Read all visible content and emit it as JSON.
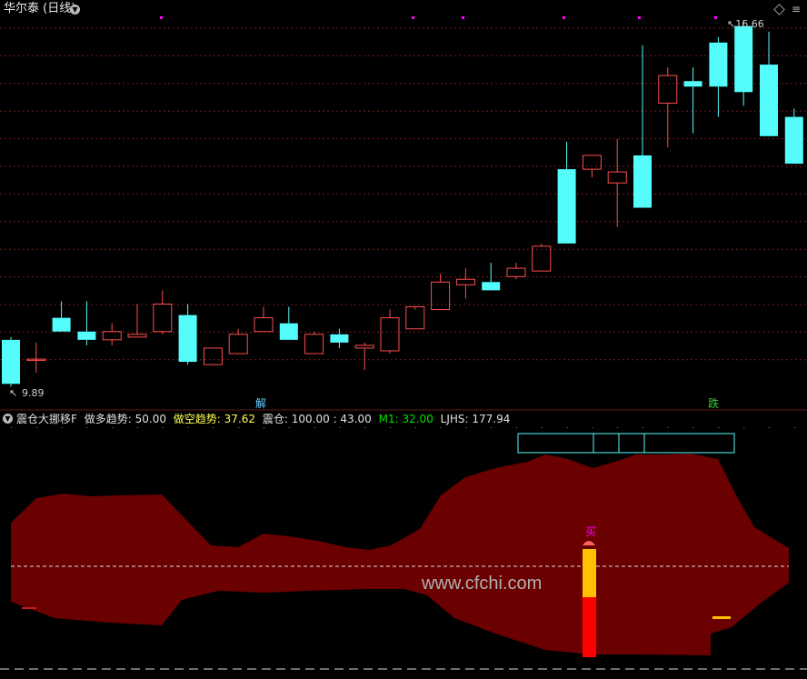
{
  "header": {
    "title": "华尔泰 (日线)",
    "dropdown_icon": "chevron-down-icon",
    "right_icons": [
      "diamond-icon",
      "menu-icon"
    ]
  },
  "price_chart": {
    "high_label": "16.66",
    "low_label": "9.89",
    "signal_tags": {
      "jie": "解",
      "die": "跌"
    },
    "candles": [
      {
        "o": 10.85,
        "h": 10.9,
        "l": 10.0,
        "c": 10.05
      },
      {
        "o": 10.5,
        "h": 10.8,
        "l": 10.25,
        "c": 10.5
      },
      {
        "o": 11.25,
        "h": 11.55,
        "l": 11.0,
        "c": 11.0
      },
      {
        "o": 11.0,
        "h": 11.55,
        "l": 10.75,
        "c": 10.85
      },
      {
        "o": 10.85,
        "h": 11.15,
        "l": 10.75,
        "c": 11.0
      },
      {
        "o": 10.9,
        "h": 11.5,
        "l": 10.9,
        "c": 10.95
      },
      {
        "o": 11.0,
        "h": 11.75,
        "l": 10.95,
        "c": 11.5
      },
      {
        "o": 11.3,
        "h": 11.5,
        "l": 10.4,
        "c": 10.45
      },
      {
        "o": 10.4,
        "h": 10.7,
        "l": 10.4,
        "c": 10.7
      },
      {
        "o": 10.6,
        "h": 11.05,
        "l": 10.6,
        "c": 10.95
      },
      {
        "o": 11.0,
        "h": 11.45,
        "l": 11.0,
        "c": 11.25
      },
      {
        "o": 11.15,
        "h": 11.45,
        "l": 10.85,
        "c": 10.85
      },
      {
        "o": 10.6,
        "h": 11.0,
        "l": 10.6,
        "c": 10.95
      },
      {
        "o": 10.95,
        "h": 11.05,
        "l": 10.7,
        "c": 10.8
      },
      {
        "o": 10.7,
        "h": 10.8,
        "l": 10.3,
        "c": 10.75
      },
      {
        "o": 10.65,
        "h": 11.4,
        "l": 10.6,
        "c": 11.25
      },
      {
        "o": 11.05,
        "h": 11.4,
        "l": 11.05,
        "c": 11.45
      },
      {
        "o": 11.4,
        "h": 12.05,
        "l": 11.4,
        "c": 11.9
      },
      {
        "o": 11.85,
        "h": 12.15,
        "l": 11.6,
        "c": 11.95
      },
      {
        "o": 11.9,
        "h": 12.25,
        "l": 11.85,
        "c": 11.75
      },
      {
        "o": 12.0,
        "h": 12.25,
        "l": 11.95,
        "c": 12.15
      },
      {
        "o": 12.1,
        "h": 12.6,
        "l": 12.1,
        "c": 12.55
      },
      {
        "o": 13.95,
        "h": 14.45,
        "l": 12.6,
        "c": 12.6
      },
      {
        "o": 13.95,
        "h": 14.2,
        "l": 13.8,
        "c": 14.2
      },
      {
        "o": 13.7,
        "h": 14.5,
        "l": 12.9,
        "c": 13.9
      },
      {
        "o": 14.2,
        "h": 16.2,
        "l": 13.6,
        "c": 13.25
      },
      {
        "o": 15.15,
        "h": 15.8,
        "l": 14.35,
        "c": 15.65
      },
      {
        "o": 15.55,
        "h": 15.8,
        "l": 14.6,
        "c": 15.45
      },
      {
        "o": 16.25,
        "h": 16.35,
        "l": 14.9,
        "c": 15.45
      },
      {
        "o": 16.55,
        "h": 16.66,
        "l": 15.1,
        "c": 15.35
      },
      {
        "o": 15.85,
        "h": 16.45,
        "l": 14.6,
        "c": 14.55
      },
      {
        "o": 14.9,
        "h": 15.05,
        "l": 14.3,
        "c": 14.05
      },
      {
        "o": 13.7,
        "h": 13.95,
        "l": 13.4,
        "c": 13.75
      }
    ]
  },
  "indicator": {
    "name": "震仓大挪移F",
    "legend": {
      "zuo_duo_label": "做多趋势:",
      "zuo_duo_value": "50.00",
      "zuo_kong_label": "做空趋势:",
      "zuo_kong_value": "37.62",
      "zhen_cang_label": "震仓:",
      "zhen_cang_value": "100.00",
      "value_43": ": 43.00",
      "m1_label": "M1:",
      "m1_value": "32.00",
      "ljhs_label": "LJHS:",
      "ljhs_value": "177.94"
    },
    "buy_tag": "买"
  },
  "watermark": "www.cfchi.com",
  "colors": {
    "bg": "#000000",
    "up": "#ff4d4d",
    "down": "#54fcfc",
    "grid": "#7a1b1b",
    "band": "#6b0000",
    "yellow": "#ffff54",
    "green": "#00e000",
    "magenta": "#ff00ff"
  }
}
